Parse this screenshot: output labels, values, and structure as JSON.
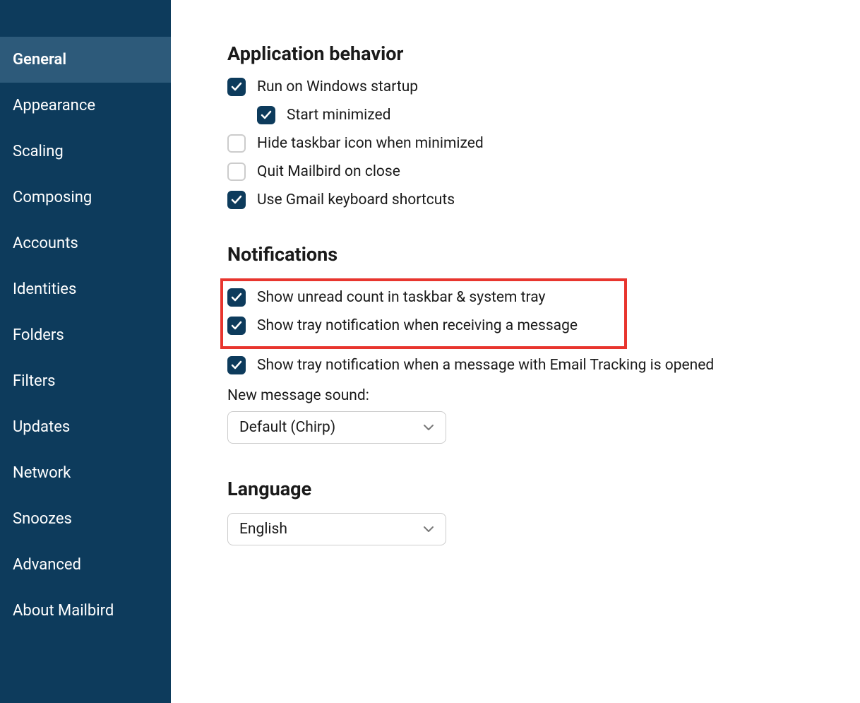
{
  "sidebar": {
    "items": [
      {
        "label": "General",
        "active": true
      },
      {
        "label": "Appearance",
        "active": false
      },
      {
        "label": "Scaling",
        "active": false
      },
      {
        "label": "Composing",
        "active": false
      },
      {
        "label": "Accounts",
        "active": false
      },
      {
        "label": "Identities",
        "active": false
      },
      {
        "label": "Folders",
        "active": false
      },
      {
        "label": "Filters",
        "active": false
      },
      {
        "label": "Updates",
        "active": false
      },
      {
        "label": "Network",
        "active": false
      },
      {
        "label": "Snoozes",
        "active": false
      },
      {
        "label": "Advanced",
        "active": false
      },
      {
        "label": "About Mailbird",
        "active": false
      }
    ]
  },
  "sections": {
    "behavior": {
      "title": "Application behavior",
      "options": {
        "run_on_startup": {
          "label": "Run on Windows startup",
          "checked": true
        },
        "start_minimized": {
          "label": "Start minimized",
          "checked": true
        },
        "hide_taskbar": {
          "label": "Hide taskbar icon when minimized",
          "checked": false
        },
        "quit_on_close": {
          "label": "Quit Mailbird on close",
          "checked": false
        },
        "gmail_shortcuts": {
          "label": "Use Gmail keyboard shortcuts",
          "checked": true
        }
      }
    },
    "notifications": {
      "title": "Notifications",
      "options": {
        "unread_count": {
          "label": "Show unread count in taskbar & system tray",
          "checked": true
        },
        "tray_notification": {
          "label": "Show tray notification when receiving a message",
          "checked": true
        },
        "email_tracking": {
          "label": "Show tray notification when a message with Email Tracking is opened",
          "checked": true
        }
      },
      "sound_label": "New message sound:",
      "sound_value": "Default (Chirp)"
    },
    "language": {
      "title": "Language",
      "value": "English"
    }
  }
}
